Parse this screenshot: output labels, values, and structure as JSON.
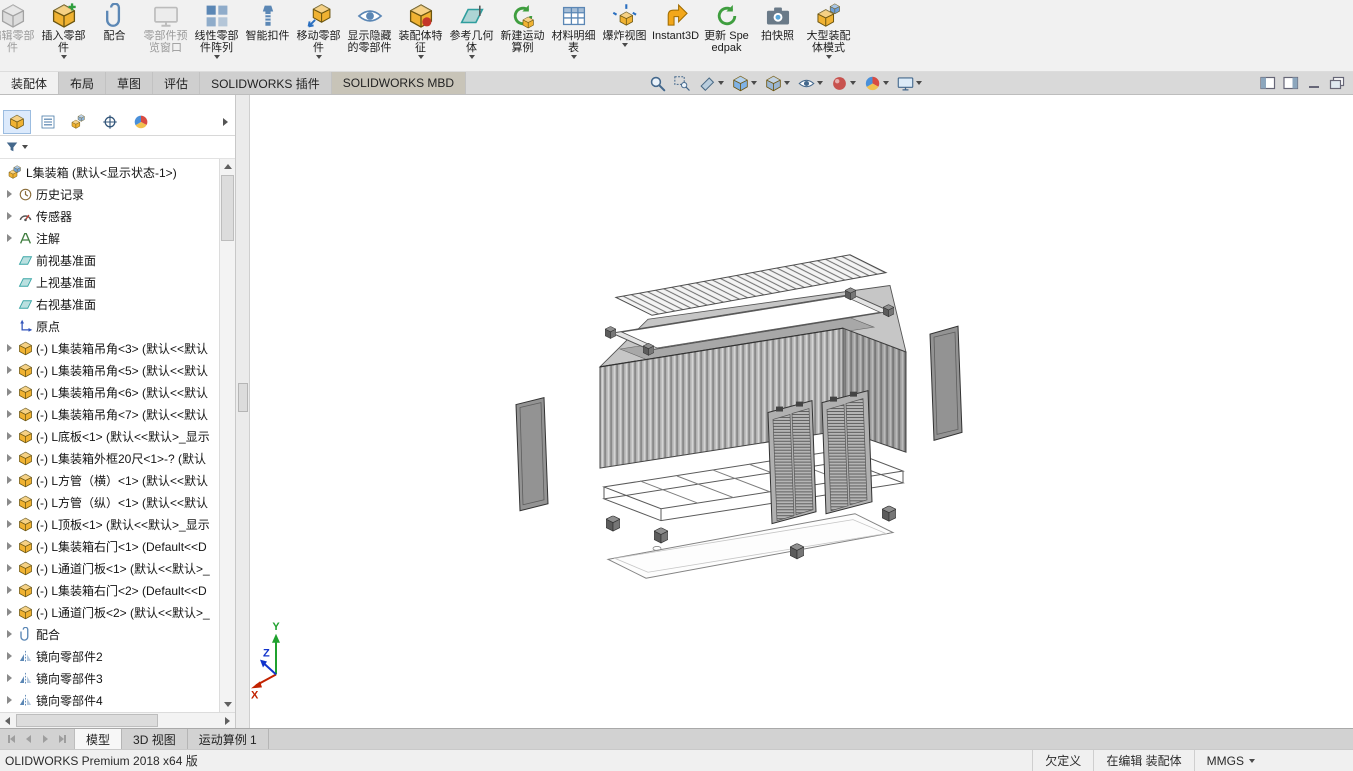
{
  "ribbon": {
    "buttons": [
      {
        "label": "编辑零部件"
      },
      {
        "label": "插入零部件"
      },
      {
        "label": "配合"
      },
      {
        "label": "零部件预览窗口"
      },
      {
        "label": "线性零部件阵列"
      },
      {
        "label": "智能扣件"
      },
      {
        "label": "移动零部件"
      },
      {
        "label": "显示隐藏的零部件"
      },
      {
        "label": "装配体特征"
      },
      {
        "label": "参考几何体"
      },
      {
        "label": "新建运动算例"
      },
      {
        "label": "材料明细表"
      },
      {
        "label": "爆炸视图"
      },
      {
        "label": "Instant3D"
      },
      {
        "label": "更新 Speedpak"
      },
      {
        "label": "拍快照"
      },
      {
        "label": "大型装配体模式"
      }
    ],
    "tabs": [
      {
        "label": "装配体"
      },
      {
        "label": "布局"
      },
      {
        "label": "草图"
      },
      {
        "label": "评估"
      },
      {
        "label": "SOLIDWORKS 插件"
      },
      {
        "label": "SOLIDWORKS MBD"
      }
    ]
  },
  "headsup": {
    "icons": [
      "zoom-to-fit",
      "zoom-to-area",
      "section-view",
      "view-orientation",
      "display-style",
      "hide-show-items",
      "edit-appearance",
      "apply-scene",
      "view-settings"
    ]
  },
  "tree": {
    "items": [
      {
        "label": "L集装箱 (默认<显示状态-1>)"
      },
      {
        "label": "历史记录"
      },
      {
        "label": "传感器"
      },
      {
        "label": "注解"
      },
      {
        "label": "前视基准面"
      },
      {
        "label": "上视基准面"
      },
      {
        "label": "右视基准面"
      },
      {
        "label": "原点"
      },
      {
        "label": "(-) L集装箱吊角<3> (默认<<默认"
      },
      {
        "label": "(-) L集装箱吊角<5> (默认<<默认"
      },
      {
        "label": "(-) L集装箱吊角<6> (默认<<默认"
      },
      {
        "label": "(-) L集装箱吊角<7> (默认<<默认"
      },
      {
        "label": "(-) L底板<1> (默认<<默认>_显示"
      },
      {
        "label": "(-) L集装箱外框20尺<1>-? (默认"
      },
      {
        "label": "(-) L方管（横）<1> (默认<<默认"
      },
      {
        "label": "(-) L方管（纵）<1> (默认<<默认"
      },
      {
        "label": "(-) L顶板<1> (默认<<默认>_显示"
      },
      {
        "label": "(-) L集装箱右门<1> (Default<<D"
      },
      {
        "label": "(-) L通道门板<1> (默认<<默认>_"
      },
      {
        "label": "(-) L集装箱右门<2> (Default<<D"
      },
      {
        "label": "(-) L通道门板<2> (默认<<默认>_"
      },
      {
        "label": "配合"
      },
      {
        "label": "镜向零部件2"
      },
      {
        "label": "镜向零部件3"
      },
      {
        "label": "镜向零部件4"
      }
    ]
  },
  "doc_tabs": {
    "model": "模型",
    "views3d": "3D 视图",
    "motion": "运动算例 1"
  },
  "status": {
    "left": "OLIDWORKS Premium 2018 x64 版",
    "defined": "欠定义",
    "editing": "在编辑 装配体",
    "units": "MMGS"
  },
  "triad": {
    "x": "X",
    "y": "Y",
    "z": "Z"
  },
  "colors": {
    "part_icon": "#f0b232",
    "accent_blue": "#5b87b5"
  }
}
